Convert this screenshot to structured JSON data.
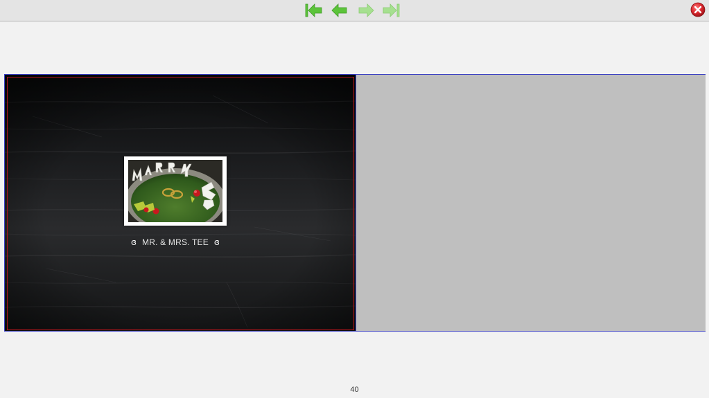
{
  "toolbar": {
    "nav_buttons": [
      {
        "name": "first-page",
        "icon": "arrow-first-icon",
        "enabled": true
      },
      {
        "name": "previous-page",
        "icon": "arrow-left-icon",
        "enabled": true
      },
      {
        "name": "next-page",
        "icon": "arrow-right-icon",
        "enabled": false
      },
      {
        "name": "last-page",
        "icon": "arrow-last-icon",
        "enabled": false
      }
    ],
    "close_icon": "close-icon"
  },
  "colors": {
    "accent_green": "#5cc43a",
    "disabled_green": "#a6e090",
    "close_red": "#d9272e",
    "spread_border": "#3a3fc4",
    "frame_red": "#a8141a",
    "empty_page": "#bfbfbf"
  },
  "spread": {
    "left_page": {
      "caption": "MR. & MRS. TEE",
      "ornament_left": "ɞ",
      "ornament_right": "ɞ"
    }
  },
  "footer": {
    "page_number": "40"
  }
}
